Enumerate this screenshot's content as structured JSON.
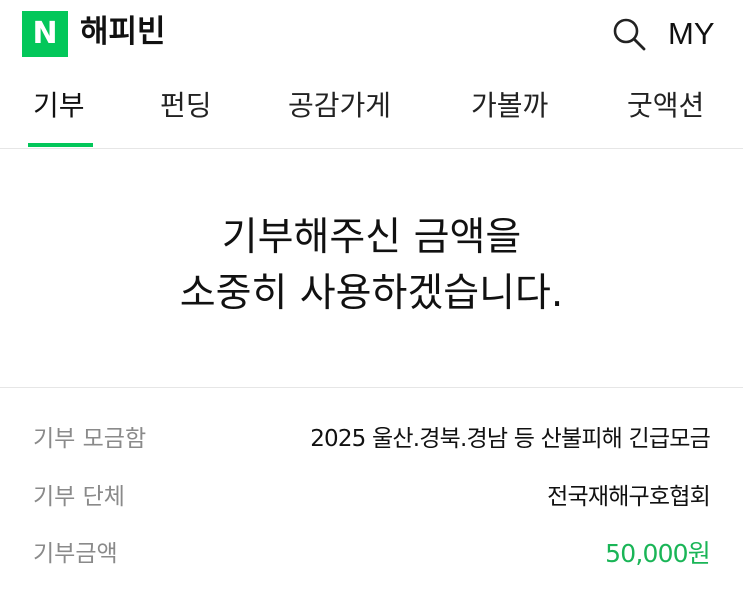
{
  "header": {
    "logo_letter": "N",
    "brand_color": "#03c75a",
    "title": "해피빈",
    "search_icon": "search-icon",
    "my_label": "MY"
  },
  "tabs": [
    {
      "label": "기부",
      "active": true
    },
    {
      "label": "펀딩",
      "active": false
    },
    {
      "label": "공감가게",
      "active": false
    },
    {
      "label": "가볼까",
      "active": false
    },
    {
      "label": "굿액션",
      "active": false
    }
  ],
  "hero": {
    "line1": "기부해주신 금액을",
    "line2": "소중히 사용하겠습니다."
  },
  "details": {
    "campaign_label": "기부 모금함",
    "campaign_value": "2025 울산.경북.경남 등 산불피해 긴급모금",
    "org_label": "기부 단체",
    "org_value": "전국재해구호협회",
    "amount_label": "기부금액",
    "amount_value": "50,000원",
    "amount_color": "#1ab557"
  }
}
